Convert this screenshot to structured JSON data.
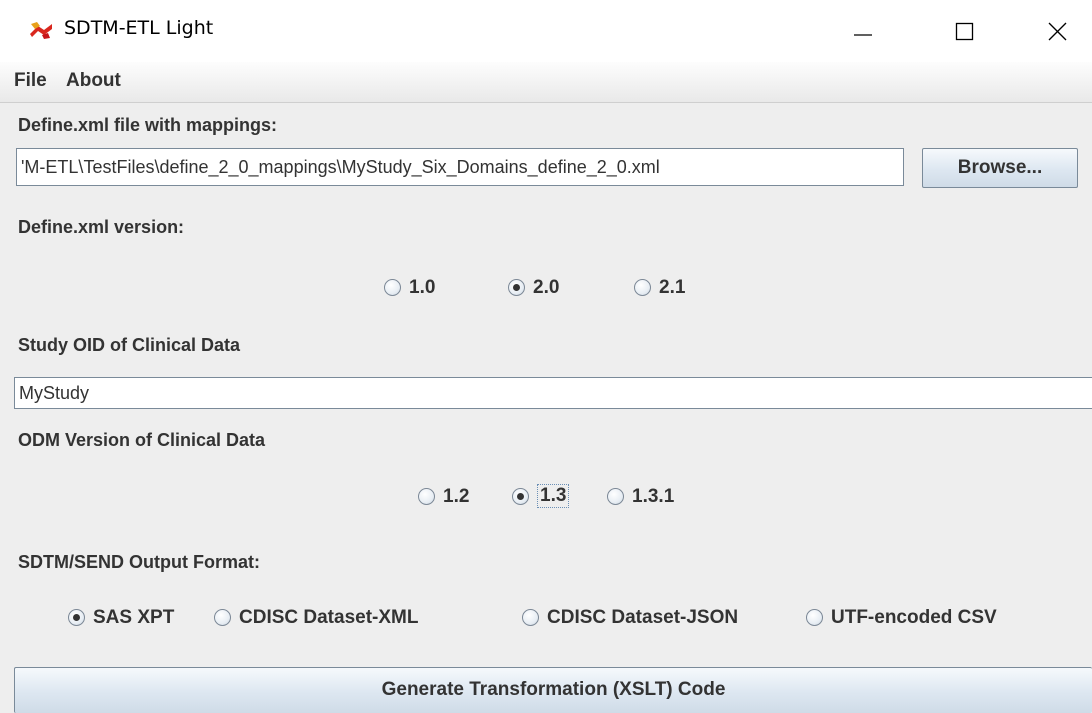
{
  "window": {
    "title": "SDTM-ETL Light"
  },
  "menu": {
    "file": "File",
    "about": "About"
  },
  "define_file": {
    "label": "Define.xml file with mappings:",
    "path": "'M-ETL\\TestFiles\\define_2_0_mappings\\MyStudy_Six_Domains_define_2_0.xml",
    "browse_label": "Browse..."
  },
  "define_version": {
    "label": "Define.xml version:",
    "options": [
      "1.0",
      "2.0",
      "2.1"
    ],
    "selected": "2.0"
  },
  "study_oid": {
    "label": "Study OID of Clinical Data",
    "value": "MyStudy"
  },
  "odm_version": {
    "label": "ODM Version of Clinical Data",
    "options": [
      "1.2",
      "1.3",
      "1.3.1"
    ],
    "selected": "1.3"
  },
  "output_format": {
    "label": "SDTM/SEND Output Format:",
    "options": [
      "SAS XPT",
      "CDISC Dataset-XML",
      "CDISC Dataset-JSON",
      "UTF-encoded CSV"
    ],
    "selected": "SAS XPT"
  },
  "generate_button": "Generate Transformation (XSLT) Code"
}
